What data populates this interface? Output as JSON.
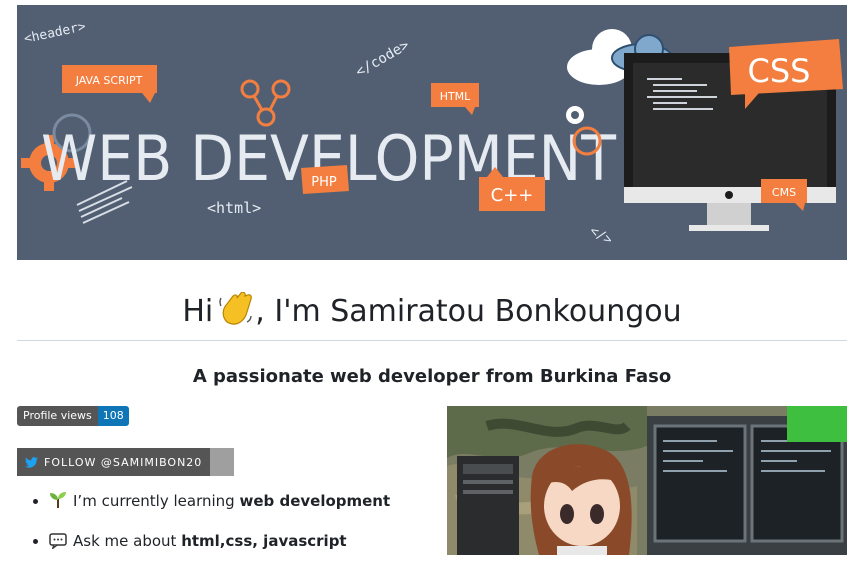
{
  "banner": {
    "title": "WEB DEVELOPMENT",
    "tags": {
      "header": "<header>",
      "javascript": "JAVA SCRIPT",
      "code": "</code>",
      "html_bubble": "HTML",
      "css": "CSS",
      "php": "PHP",
      "cpp": "C++",
      "cms": "CMS",
      "html_tag": "<html>",
      "slash": "</>"
    }
  },
  "profile": {
    "greeting_pre": "Hi",
    "greeting_post": ", I'm Samiratou Bonkoungou",
    "subtitle": "A passionate web developer from Burkina Faso",
    "views_label": "Profile views",
    "views_count": "108",
    "follow_label": "FOLLOW @SAMIMIBON20"
  },
  "about": [
    {
      "text": "I’m currently learning ",
      "bold": "web development",
      "icon": "seedling-icon"
    },
    {
      "text": "Ask me about ",
      "bold": "html,css, javascript",
      "icon": "speech-bubble-icon"
    }
  ],
  "colors": {
    "banner_bg": "#525f73",
    "accent": "#f37e3f",
    "badge_blue": "#0e75b6"
  }
}
